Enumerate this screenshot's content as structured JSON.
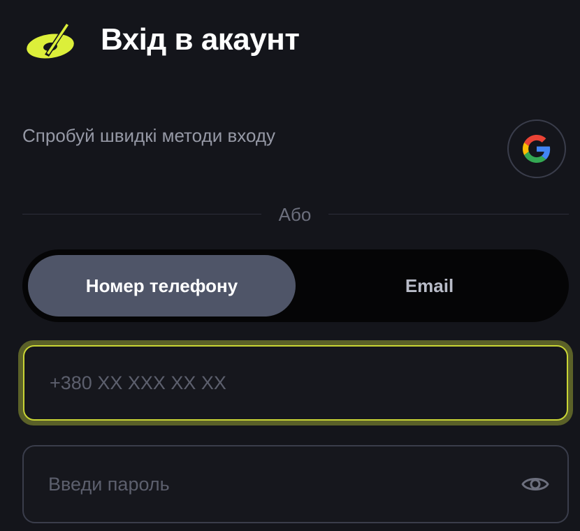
{
  "header": {
    "logo_icon": "brand-logo-icon",
    "title": "Вхід в акаунт"
  },
  "quick_login": {
    "text": "Спробуй швидкі методи входу",
    "google_icon": "google-icon"
  },
  "divider": {
    "text": "Або"
  },
  "tabs": [
    {
      "label": "Номер телефону",
      "active": true
    },
    {
      "label": "Email",
      "active": false
    }
  ],
  "phone_field": {
    "value": "",
    "placeholder": "+380 XX XXX XX XX"
  },
  "password_field": {
    "value": "",
    "placeholder": "Введи пароль",
    "toggle_icon": "eye-icon"
  },
  "colors": {
    "background": "#14151b",
    "accent": "#c9d535",
    "active_tab": "#4f5568"
  }
}
